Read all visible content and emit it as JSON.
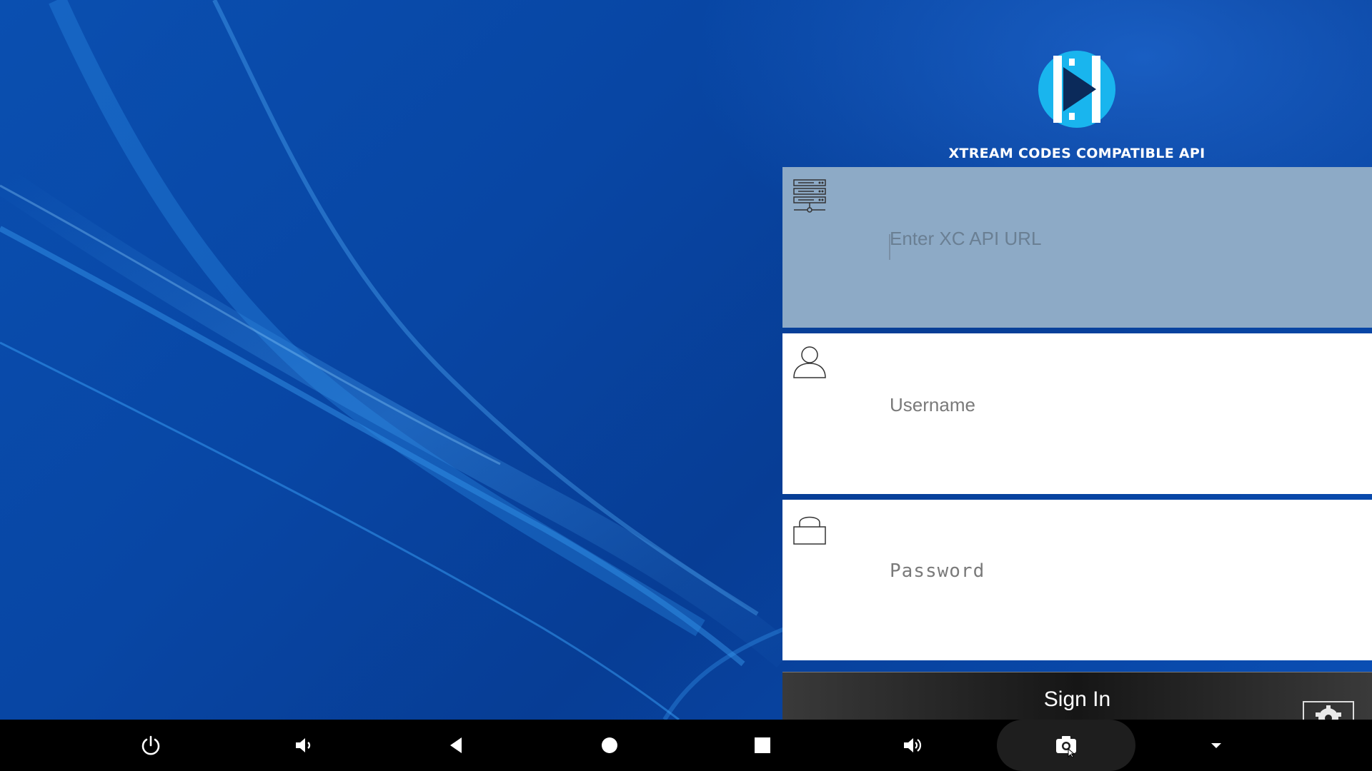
{
  "brand": {
    "title": "XTREAM CODES COMPATIBLE API",
    "logo_icon": "play-logo-icon",
    "accent": "#19b5ee"
  },
  "form": {
    "url_placeholder": "Enter XC API URL",
    "url_value": "",
    "username_placeholder": "Username",
    "username_value": "",
    "password_placeholder": "Password",
    "password_value": "",
    "signin_label": "Sign In",
    "icons": [
      "server-icon",
      "user-icon",
      "lock-icon",
      "gear-icon"
    ]
  },
  "navbar": {
    "items": [
      "power-icon",
      "volume-down-icon",
      "back-icon",
      "home-icon",
      "recents-icon",
      "volume-up-icon",
      "screenshot-icon",
      "dropdown-icon"
    ]
  },
  "colors": {
    "background": "#0a4aa8",
    "url_field": "#8daac6",
    "field": "#ffffff",
    "navbar": "#000000"
  }
}
